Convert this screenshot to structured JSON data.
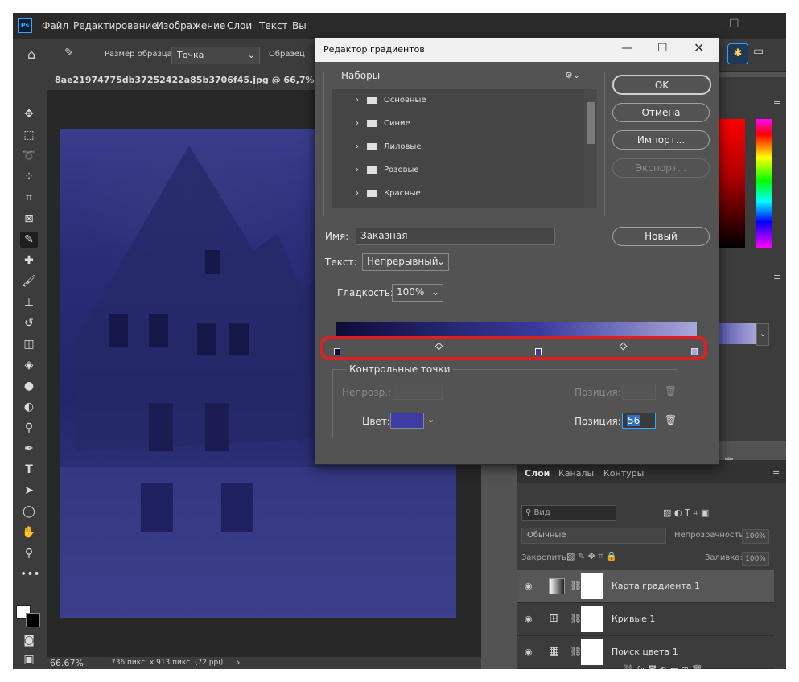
{
  "app": {
    "logo": "Ps",
    "menu": [
      "Файл",
      "Редактирование",
      "Изображение",
      "Слои",
      "Текст",
      "Вы"
    ]
  },
  "options_bar": {
    "sample_size_label": "Размер образца:",
    "sample_size_value": "Точка",
    "sample_label": "Образец"
  },
  "document": {
    "tab_title": "8ae21974775db37252422a85b3706f45.jpg @ 66,7% (Карта",
    "zoom": "66.67%",
    "info": "736 пикс. x 913 пикс. (72 ppi)"
  },
  "dialog": {
    "title": "Редактор градиентов",
    "presets_label": "Наборы",
    "presets": [
      "Основные",
      "Синие",
      "Лиловые",
      "Розовые",
      "Красные"
    ],
    "buttons": {
      "ok": "OK",
      "cancel": "Отмена",
      "import": "Импорт...",
      "export": "Экспорт...",
      "new": "Новый"
    },
    "name_label": "Имя:",
    "name_value": "Заказная",
    "type_label": "Текст:",
    "type_value": "Непрерывный",
    "smooth_label": "Гладкость:",
    "smooth_value": "100%",
    "gradient": {
      "start_color": "#0d0d3a",
      "mid_color": "#3a3a9e",
      "end_color": "#a8a8d8",
      "selected_stop_percent": 56
    },
    "stops_label": "Контрольные точки",
    "opacity_label": "Непрозр.:",
    "position_label": "Позиция:",
    "color_label": "Цвет:",
    "color_value": "#3c3ca2",
    "color_position_value": "56",
    "highlight_color": "#e31e1e"
  },
  "layers": {
    "tabs": [
      "Слои",
      "Каналы",
      "Контуры"
    ],
    "search_placeholder": "Вид",
    "blend_mode": "Обычные",
    "opacity_label": "Непрозрачность:",
    "opacity_value": "100%",
    "lock_label": "Закрепить:",
    "fill_label": "Заливка:",
    "fill_value": "100%",
    "items": [
      {
        "name": "Карта градиента 1"
      },
      {
        "name": "Кривые 1"
      },
      {
        "name": "Поиск цвета 1"
      }
    ]
  }
}
